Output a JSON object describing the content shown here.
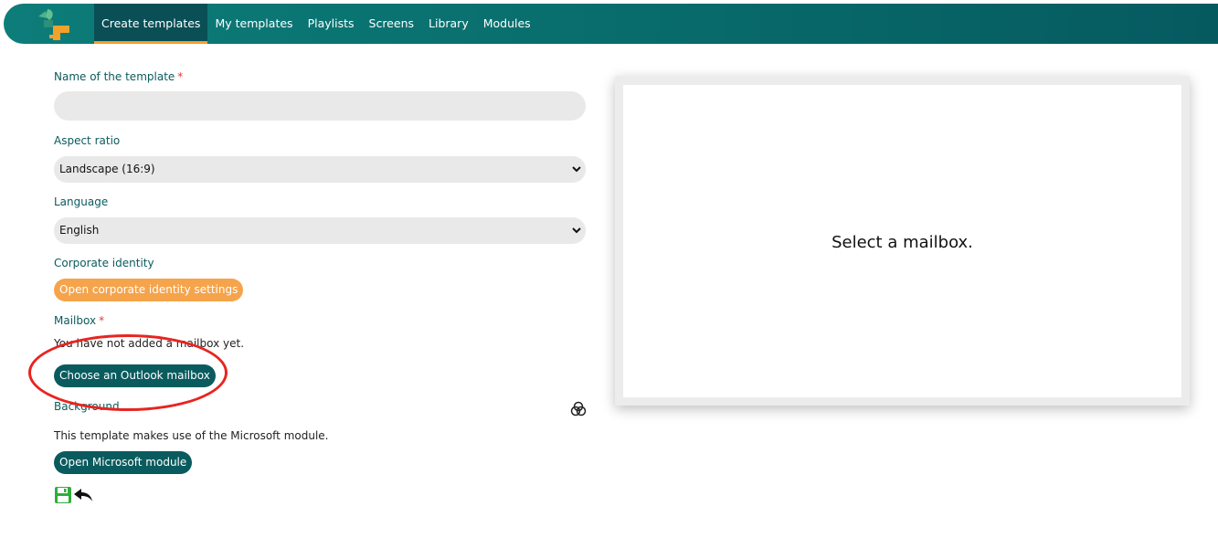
{
  "nav": {
    "items": [
      {
        "label": "Create templates",
        "active": true
      },
      {
        "label": "My templates"
      },
      {
        "label": "Playlists"
      },
      {
        "label": "Screens"
      },
      {
        "label": "Library"
      },
      {
        "label": "Modules"
      }
    ]
  },
  "form": {
    "name_label": "Name of the template",
    "required_mark": "*",
    "name_value": "",
    "aspect_label": "Aspect ratio",
    "aspect_value": "Landscape (16:9)",
    "language_label": "Language",
    "language_value": "English",
    "corporate_label": "Corporate identity",
    "corporate_button": "Open corporate identity settings",
    "mailbox_label": "Mailbox",
    "mailbox_empty_text": "You have not added a mailbox yet.",
    "mailbox_button": "Choose an Outlook mailbox",
    "background_label": "Background",
    "module_text": "This template makes use of the  Microsoft module.",
    "module_button": "Open  Microsoft module"
  },
  "preview": {
    "message": "Select a mailbox."
  },
  "colors": {
    "nav_bg": "#086b6b",
    "accent_orange": "#f5a44c",
    "teal_button": "#0a5b5e",
    "highlight": "#e8241f"
  }
}
